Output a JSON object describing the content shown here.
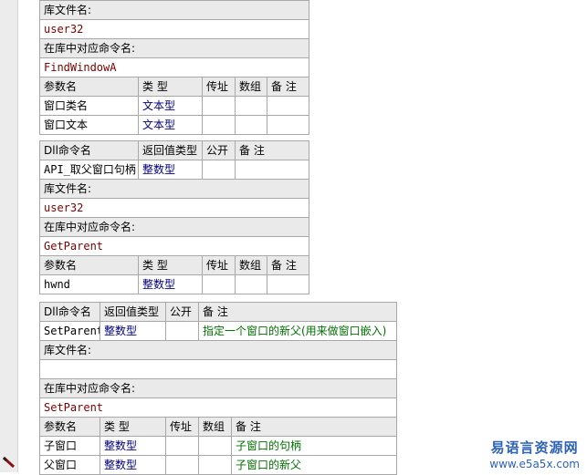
{
  "block1": {
    "lib_label": "库文件名:",
    "lib_value": "user32",
    "cmd_label": "在库中对应命令名:",
    "cmd_value": "FindWindowA",
    "param_headers": [
      "参数名",
      "类 型",
      "传址",
      "数组",
      "备 注"
    ],
    "params": [
      {
        "name": "窗口类名",
        "type": "文本型"
      },
      {
        "name": "窗口文本",
        "type": "文本型"
      }
    ]
  },
  "block2": {
    "headers": [
      "Dll命令名",
      "返回值类型",
      "公开",
      "备 注"
    ],
    "name": "API_取父窗口句柄",
    "ret": "整数型",
    "lib_label": "库文件名:",
    "lib_value": "user32",
    "cmd_label": "在库中对应命令名:",
    "cmd_value": "GetParent",
    "param_headers": [
      "参数名",
      "类 型",
      "传址",
      "数组",
      "备 注"
    ],
    "params": [
      {
        "name": "hwnd",
        "type": "整数型"
      }
    ]
  },
  "block3": {
    "headers": [
      "Dll命令名",
      "返回值类型",
      "公开",
      "备 注"
    ],
    "name": "SetParent",
    "ret": "整数型",
    "note": "指定一个窗口的新父(用来做窗口嵌入)",
    "lib_label": "库文件名:",
    "cmd_label": "在库中对应命令名:",
    "cmd_value": "SetParent",
    "param_headers": [
      "参数名",
      "类 型",
      "传址",
      "数组",
      "备 注"
    ],
    "params": [
      {
        "name": "子窗口",
        "type": "整数型",
        "note": "子窗口的句柄"
      },
      {
        "name": "父窗口",
        "type": "整数型",
        "note": "子窗口的新父"
      }
    ]
  },
  "watermark": {
    "brand": "易语言资源网",
    "url": "www.e5a5x.com"
  }
}
